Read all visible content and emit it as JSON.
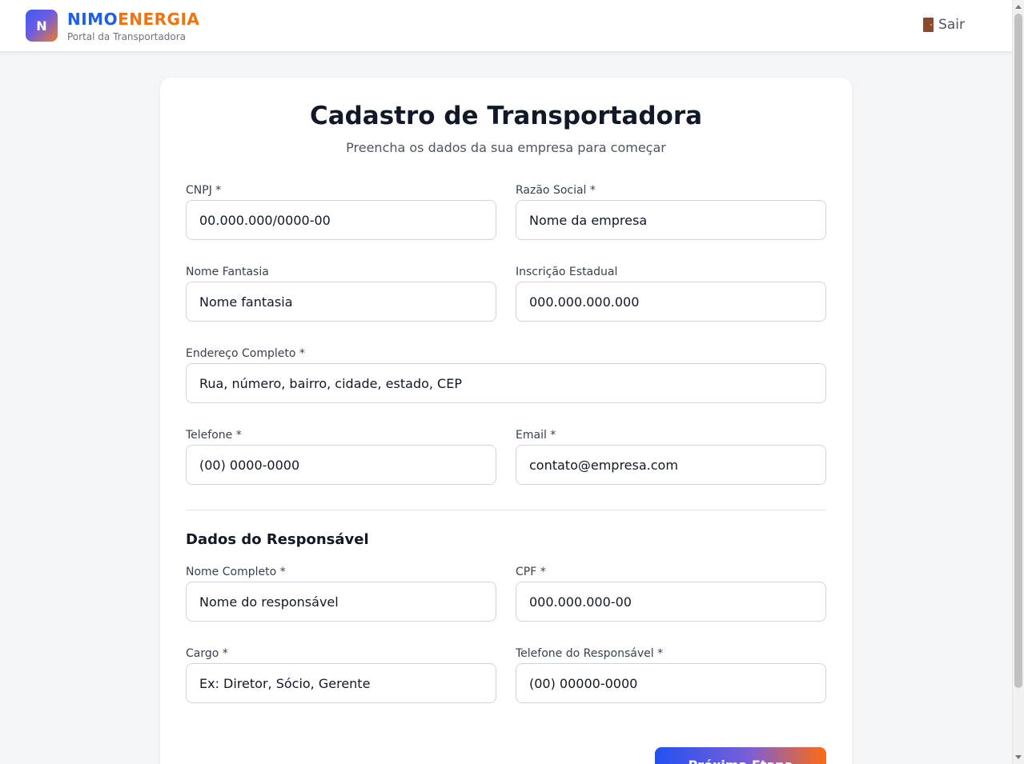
{
  "header": {
    "logo_letter": "N",
    "brand_part1": "NIMO",
    "brand_part2": "ENERGIA",
    "subtitle": "Portal da Transportadora",
    "logout_label": "Sair"
  },
  "form": {
    "title": "Cadastro de Transportadora",
    "subtitle": "Preencha os dados da sua empresa para começar",
    "cnpj": {
      "label": "CNPJ *",
      "placeholder": "00.000.000/0000-00"
    },
    "razao_social": {
      "label": "Razão Social *",
      "placeholder": "Nome da empresa"
    },
    "nome_fantasia": {
      "label": "Nome Fantasia",
      "placeholder": "Nome fantasia"
    },
    "inscricao_estadual": {
      "label": "Inscrição Estadual",
      "placeholder": "000.000.000.000"
    },
    "endereco": {
      "label": "Endereço Completo *",
      "placeholder": "Rua, número, bairro, cidade, estado, CEP"
    },
    "telefone": {
      "label": "Telefone *",
      "placeholder": "(00) 0000-0000"
    },
    "email": {
      "label": "Email *",
      "placeholder": "contato@empresa.com"
    },
    "responsavel_section": "Dados do Responsável",
    "nome_completo": {
      "label": "Nome Completo *",
      "placeholder": "Nome do responsável"
    },
    "cpf": {
      "label": "CPF *",
      "placeholder": "000.000.000-00"
    },
    "cargo": {
      "label": "Cargo *",
      "placeholder": "Ex: Diretor, Sócio, Gerente"
    },
    "telefone_responsavel": {
      "label": "Telefone do Responsável *",
      "placeholder": "(00) 00000-0000"
    },
    "next_button": "Próxima Etapa"
  },
  "colors": {
    "brand_blue": "#1f5ee8",
    "brand_orange": "#f0730f"
  }
}
